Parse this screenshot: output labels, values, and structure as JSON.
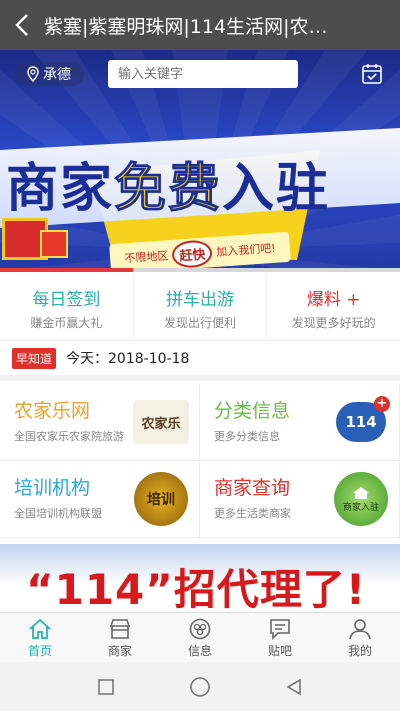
{
  "header": {
    "title": "紫塞|紫塞明珠网|114生活网|农…"
  },
  "banner": {
    "location": "承德",
    "search_placeholder": "输入关键字",
    "headline_left": "商家",
    "headline_mid": "免费",
    "headline_right": "入驻",
    "sub_left": "不限地区",
    "sub_speed": "赶快",
    "sub_right": "加入我们吧!"
  },
  "quick": [
    {
      "title": "每日签到",
      "sub": "赚金币赢大礼",
      "color": "#2ab0a8"
    },
    {
      "title": "拼车出游",
      "sub": "发现出行便利",
      "color": "#2ab0a8"
    },
    {
      "title": "爆料 +",
      "sub": "发现更多好玩的",
      "color": "#e0302c"
    }
  ],
  "news": {
    "tag": "早知道",
    "text": "今天：2018-10-18"
  },
  "grid": [
    {
      "title": "农家乐网",
      "sub": "全国农家乐农家院旅游",
      "color": "#e8a22a",
      "pic": "农家乐"
    },
    {
      "title": "分类信息",
      "sub": "更多分类信息",
      "color": "#6fb84a",
      "pic": "114"
    },
    {
      "title": "培训机构",
      "sub": "全国培训机构联盟",
      "color": "#2aa8d8",
      "pic": "培训"
    },
    {
      "title": "商家查询",
      "sub": "更多生活类商家",
      "color": "#e0302c",
      "pic": "商家入驻"
    }
  ],
  "ad": {
    "text": "“114”招代理了!"
  },
  "tabs": [
    {
      "label": "首页",
      "icon": "home-icon"
    },
    {
      "label": "商家",
      "icon": "shop-icon"
    },
    {
      "label": "信息",
      "icon": "info-icon"
    },
    {
      "label": "贴吧",
      "icon": "forum-icon"
    },
    {
      "label": "我的",
      "icon": "user-icon"
    }
  ],
  "colors": {
    "accent": "#1ab3a7",
    "topbar": "#4d4d4d",
    "red": "#e0302c"
  }
}
